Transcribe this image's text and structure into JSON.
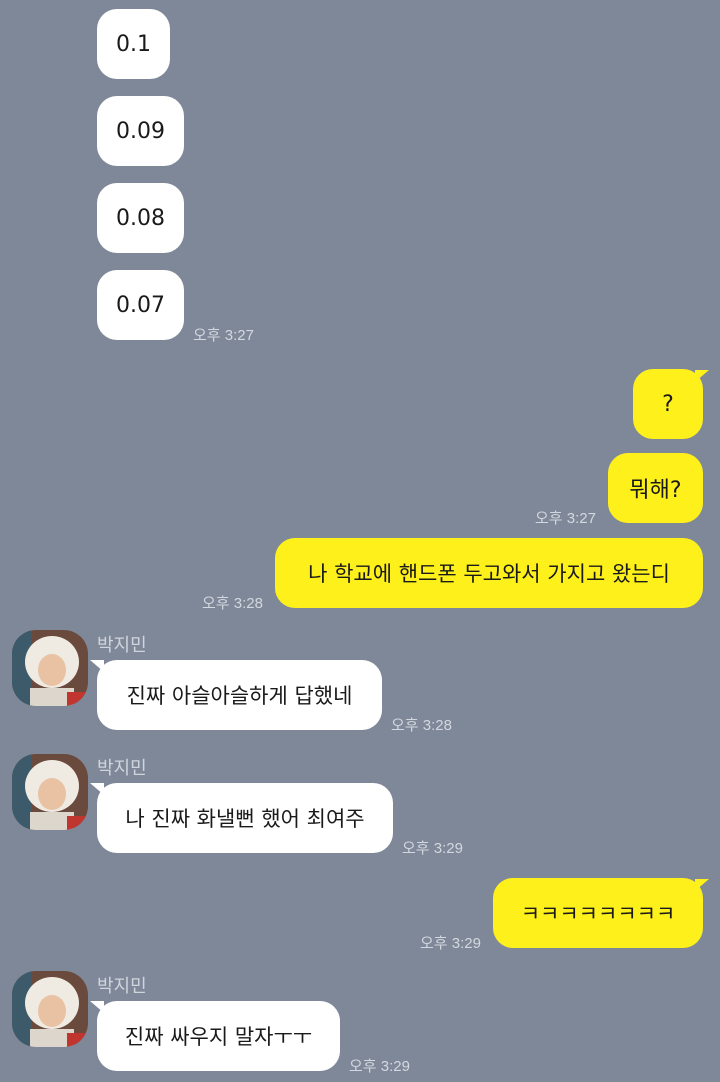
{
  "messages": {
    "m1": "0.1",
    "m2": "0.09",
    "m3": "0.08",
    "m4": "0.07",
    "t1": "오후 3:27",
    "m5": "?",
    "m6": "뭐해?",
    "t2": "오후 3:27",
    "m7": "나 학교에 핸드폰 두고와서 가지고 왔는디",
    "t3": "오후 3:28",
    "n1": "박지민",
    "m8": "진짜 아슬아슬하게 답했네",
    "t4": "오후 3:28",
    "n2": "박지민",
    "m9": "나 진짜 화낼뻔 했어 최여주",
    "t5": "오후 3:29",
    "m10": "ㅋㅋㅋㅋㅋㅋㅋㅋ",
    "t6": "오후 3:29",
    "n3": "박지민",
    "m11": "진짜 싸우지 말자ㅜㅜ",
    "t7": "오후 3:29"
  },
  "colors": {
    "background": "#7f8898",
    "my_bubble": "#fef01b",
    "their_bubble": "#ffffff"
  }
}
